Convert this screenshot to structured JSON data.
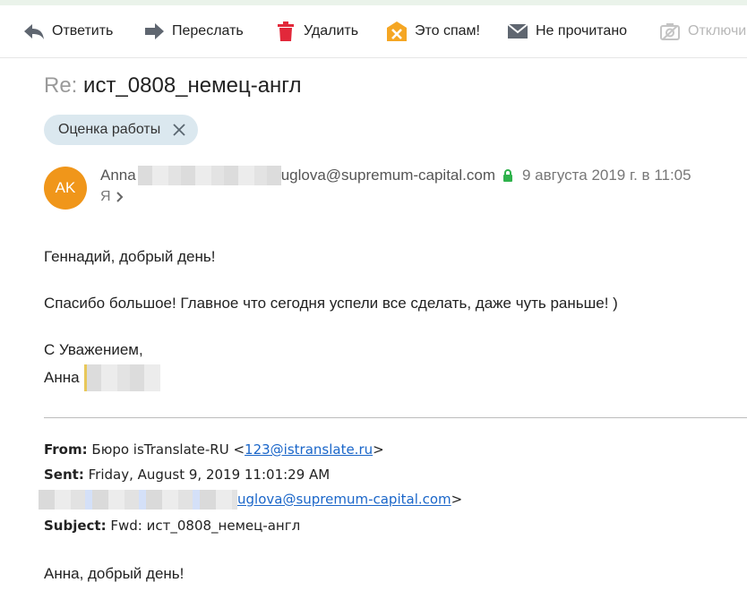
{
  "toolbar": {
    "reply": "Ответить",
    "forward": "Переслать",
    "delete": "Удалить",
    "spam": "Это спам!",
    "unread": "Не прочитано",
    "disable": "Отключи"
  },
  "message": {
    "subject_prefix": "Re:",
    "subject": "ист_0808_немец-англ",
    "label": "Оценка работы",
    "avatar_initials": "AK",
    "sender_name": "Anna",
    "sender_email_tail": "uglova@supremum-capital.com",
    "date": "9 августа 2019 г. в 11:05",
    "to": "Я",
    "body": {
      "greeting": "Геннадий, добрый день!",
      "line1": "Спасибо большое! Главное что сегодня успели все сделать, даже чуть раньше! )",
      "closing": "С Уважением,",
      "signature": "Анна"
    }
  },
  "quoted": {
    "from_label": "From:",
    "from_name": "Бюро isTranslate-RU <",
    "from_email": "123@istranslate.ru",
    "from_close": ">",
    "sent_label": "Sent:",
    "sent_value": "Friday, August 9, 2019 11:01:29 AM",
    "to_email_tail": "uglova@supremum-capital.com",
    "to_close": ">",
    "subject_label": "Subject:",
    "subject_value": "Fwd: ист_0808_немец-англ",
    "greeting": "Анна, добрый день!"
  },
  "colors": {
    "avatar": "#f0961a",
    "chip": "#dbe8ef",
    "link": "#1a66c9",
    "spam_icon": "#f5a623",
    "delete_icon": "#e2283a",
    "lock": "#2fb24c"
  }
}
